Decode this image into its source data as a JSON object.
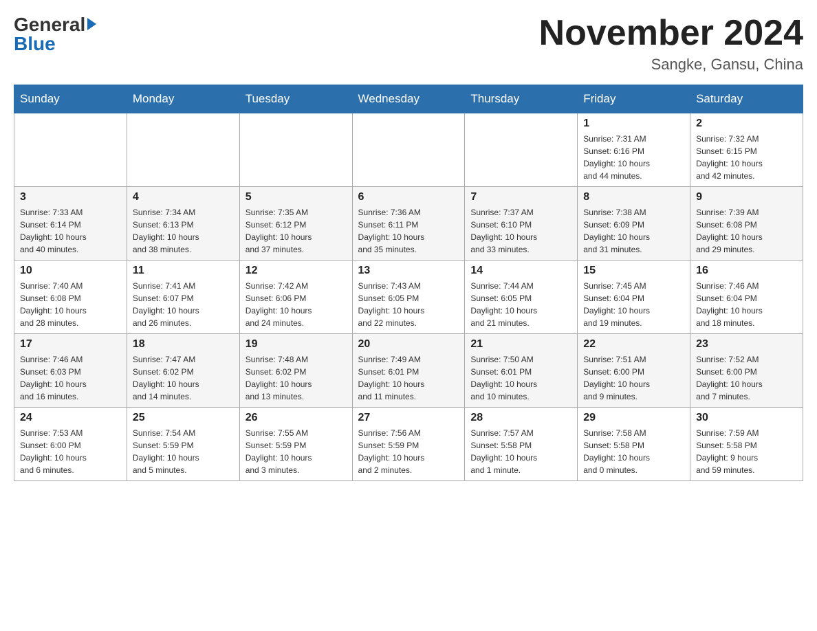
{
  "header": {
    "logo_general": "General",
    "logo_blue": "Blue",
    "month_title": "November 2024",
    "location": "Sangke, Gansu, China"
  },
  "weekdays": [
    "Sunday",
    "Monday",
    "Tuesday",
    "Wednesday",
    "Thursday",
    "Friday",
    "Saturday"
  ],
  "weeks": [
    [
      {
        "day": "",
        "info": ""
      },
      {
        "day": "",
        "info": ""
      },
      {
        "day": "",
        "info": ""
      },
      {
        "day": "",
        "info": ""
      },
      {
        "day": "",
        "info": ""
      },
      {
        "day": "1",
        "info": "Sunrise: 7:31 AM\nSunset: 6:16 PM\nDaylight: 10 hours\nand 44 minutes."
      },
      {
        "day": "2",
        "info": "Sunrise: 7:32 AM\nSunset: 6:15 PM\nDaylight: 10 hours\nand 42 minutes."
      }
    ],
    [
      {
        "day": "3",
        "info": "Sunrise: 7:33 AM\nSunset: 6:14 PM\nDaylight: 10 hours\nand 40 minutes."
      },
      {
        "day": "4",
        "info": "Sunrise: 7:34 AM\nSunset: 6:13 PM\nDaylight: 10 hours\nand 38 minutes."
      },
      {
        "day": "5",
        "info": "Sunrise: 7:35 AM\nSunset: 6:12 PM\nDaylight: 10 hours\nand 37 minutes."
      },
      {
        "day": "6",
        "info": "Sunrise: 7:36 AM\nSunset: 6:11 PM\nDaylight: 10 hours\nand 35 minutes."
      },
      {
        "day": "7",
        "info": "Sunrise: 7:37 AM\nSunset: 6:10 PM\nDaylight: 10 hours\nand 33 minutes."
      },
      {
        "day": "8",
        "info": "Sunrise: 7:38 AM\nSunset: 6:09 PM\nDaylight: 10 hours\nand 31 minutes."
      },
      {
        "day": "9",
        "info": "Sunrise: 7:39 AM\nSunset: 6:08 PM\nDaylight: 10 hours\nand 29 minutes."
      }
    ],
    [
      {
        "day": "10",
        "info": "Sunrise: 7:40 AM\nSunset: 6:08 PM\nDaylight: 10 hours\nand 28 minutes."
      },
      {
        "day": "11",
        "info": "Sunrise: 7:41 AM\nSunset: 6:07 PM\nDaylight: 10 hours\nand 26 minutes."
      },
      {
        "day": "12",
        "info": "Sunrise: 7:42 AM\nSunset: 6:06 PM\nDaylight: 10 hours\nand 24 minutes."
      },
      {
        "day": "13",
        "info": "Sunrise: 7:43 AM\nSunset: 6:05 PM\nDaylight: 10 hours\nand 22 minutes."
      },
      {
        "day": "14",
        "info": "Sunrise: 7:44 AM\nSunset: 6:05 PM\nDaylight: 10 hours\nand 21 minutes."
      },
      {
        "day": "15",
        "info": "Sunrise: 7:45 AM\nSunset: 6:04 PM\nDaylight: 10 hours\nand 19 minutes."
      },
      {
        "day": "16",
        "info": "Sunrise: 7:46 AM\nSunset: 6:04 PM\nDaylight: 10 hours\nand 18 minutes."
      }
    ],
    [
      {
        "day": "17",
        "info": "Sunrise: 7:46 AM\nSunset: 6:03 PM\nDaylight: 10 hours\nand 16 minutes."
      },
      {
        "day": "18",
        "info": "Sunrise: 7:47 AM\nSunset: 6:02 PM\nDaylight: 10 hours\nand 14 minutes."
      },
      {
        "day": "19",
        "info": "Sunrise: 7:48 AM\nSunset: 6:02 PM\nDaylight: 10 hours\nand 13 minutes."
      },
      {
        "day": "20",
        "info": "Sunrise: 7:49 AM\nSunset: 6:01 PM\nDaylight: 10 hours\nand 11 minutes."
      },
      {
        "day": "21",
        "info": "Sunrise: 7:50 AM\nSunset: 6:01 PM\nDaylight: 10 hours\nand 10 minutes."
      },
      {
        "day": "22",
        "info": "Sunrise: 7:51 AM\nSunset: 6:00 PM\nDaylight: 10 hours\nand 9 minutes."
      },
      {
        "day": "23",
        "info": "Sunrise: 7:52 AM\nSunset: 6:00 PM\nDaylight: 10 hours\nand 7 minutes."
      }
    ],
    [
      {
        "day": "24",
        "info": "Sunrise: 7:53 AM\nSunset: 6:00 PM\nDaylight: 10 hours\nand 6 minutes."
      },
      {
        "day": "25",
        "info": "Sunrise: 7:54 AM\nSunset: 5:59 PM\nDaylight: 10 hours\nand 5 minutes."
      },
      {
        "day": "26",
        "info": "Sunrise: 7:55 AM\nSunset: 5:59 PM\nDaylight: 10 hours\nand 3 minutes."
      },
      {
        "day": "27",
        "info": "Sunrise: 7:56 AM\nSunset: 5:59 PM\nDaylight: 10 hours\nand 2 minutes."
      },
      {
        "day": "28",
        "info": "Sunrise: 7:57 AM\nSunset: 5:58 PM\nDaylight: 10 hours\nand 1 minute."
      },
      {
        "day": "29",
        "info": "Sunrise: 7:58 AM\nSunset: 5:58 PM\nDaylight: 10 hours\nand 0 minutes."
      },
      {
        "day": "30",
        "info": "Sunrise: 7:59 AM\nSunset: 5:58 PM\nDaylight: 9 hours\nand 59 minutes."
      }
    ]
  ]
}
